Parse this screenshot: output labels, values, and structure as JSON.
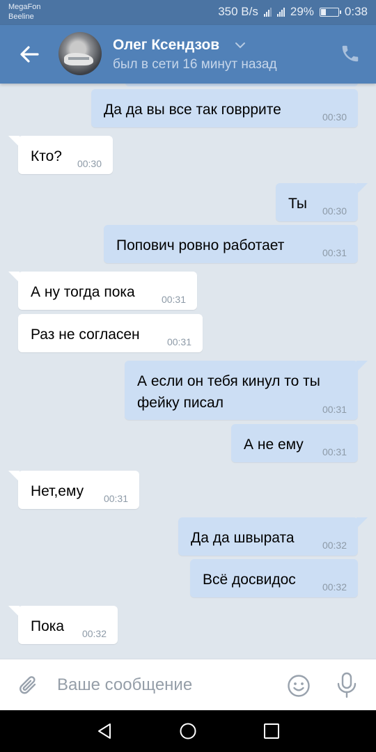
{
  "status_bar": {
    "carrier_1": "MegaFon",
    "carrier_2": "Beeline",
    "speed": "350 B/s",
    "battery": "29%",
    "battery_level": 0.29,
    "time": "0:38"
  },
  "header": {
    "contact_name": "Олег Ксендзов",
    "contact_status": "был в сети 16 минут назад"
  },
  "messages": [
    {
      "direction": "out",
      "text": "Да да вы все так говррите",
      "time": "00:30"
    },
    {
      "direction": "in",
      "text": "Кто?",
      "time": "00:30"
    },
    {
      "direction": "out",
      "text": "Ты",
      "time": "00:30"
    },
    {
      "direction": "out",
      "text": "Попович ровно работает",
      "time": "00:31"
    },
    {
      "direction": "in",
      "text": "А ну тогда пока",
      "time": "00:31"
    },
    {
      "direction": "in",
      "text": "Раз не согласен",
      "time": "00:31"
    },
    {
      "direction": "out",
      "text": "А если он тебя кинул то ты фейку писал",
      "time": "00:31"
    },
    {
      "direction": "out",
      "text": "А не ему",
      "time": "00:31"
    },
    {
      "direction": "in",
      "text": "Нет,ему",
      "time": "00:31"
    },
    {
      "direction": "out",
      "text": "Да да швырата",
      "time": "00:32"
    },
    {
      "direction": "out",
      "text": "Всё досвидос",
      "time": "00:32"
    },
    {
      "direction": "in",
      "text": "Пока",
      "time": "00:32"
    }
  ],
  "composer": {
    "placeholder": "Ваше сообщение"
  },
  "colors": {
    "header": "#5181b8",
    "status_bar": "#4b74a3",
    "chat_background": "#dfe6ed",
    "incoming_bubble": "#ffffff",
    "outgoing_bubble": "#ccdef4",
    "icon_gray": "#99a2ad"
  },
  "icons": {
    "back": "arrow-left-icon",
    "name_dropdown": "chevron-down-icon",
    "call": "phone-icon",
    "attach": "paperclip-icon",
    "emoji": "smiley-icon",
    "mic": "microphone-icon",
    "nav_back": "triangle-back-icon",
    "nav_home": "circle-home-icon",
    "nav_recents": "square-recents-icon"
  }
}
